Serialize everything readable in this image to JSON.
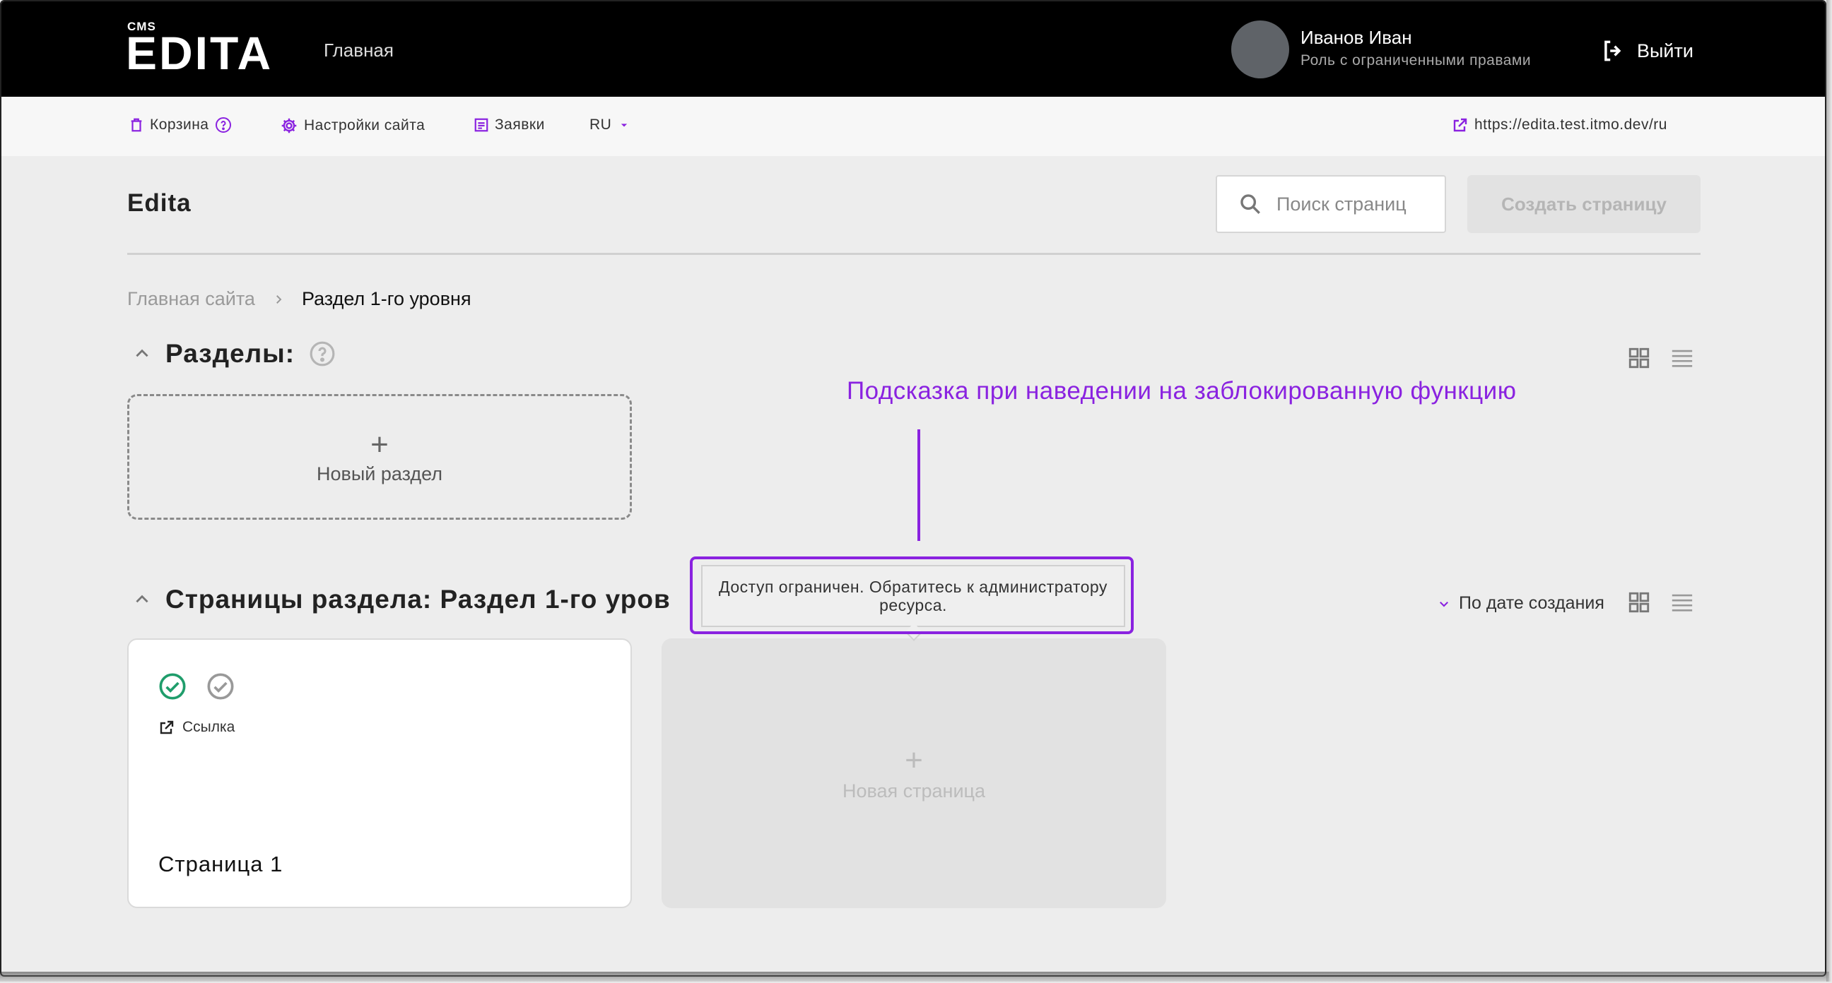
{
  "header": {
    "logo_small": "CMS",
    "logo": "EDITA",
    "nav_home": "Главная",
    "user_name": "Иванов Иван",
    "user_role": "Роль с ограниченными правами",
    "logout_label": "Выйти"
  },
  "toolbar": {
    "trash_label": "Корзина",
    "settings_label": "Настройки сайта",
    "requests_label": "Заявки",
    "language": "RU",
    "site_url": "https://edita.test.itmo.dev/ru"
  },
  "main": {
    "title": "Edita",
    "search_placeholder": "Поиск страниц",
    "create_button": "Создать страницу",
    "breadcrumb": [
      "Главная сайта",
      "Раздел 1-го уровня"
    ],
    "sections": {
      "title": "Разделы:",
      "new_section_label": "Новый раздел"
    },
    "pages": {
      "title": "Страницы раздела: Раздел 1-го уров",
      "sort_label": "По дате создания",
      "card": {
        "link_label": "Ссылка",
        "title": "Страница 1"
      },
      "new_page_label": "Новая страница"
    }
  },
  "annotation": {
    "caption": "Подсказка при наведении на заблокированную функцию",
    "tooltip": "Доступ ограничен. Обратитесь к администратору ресурса."
  },
  "colors": {
    "accent": "#8a22e0",
    "header_bg": "#000000",
    "success": "#1f9d6b"
  }
}
